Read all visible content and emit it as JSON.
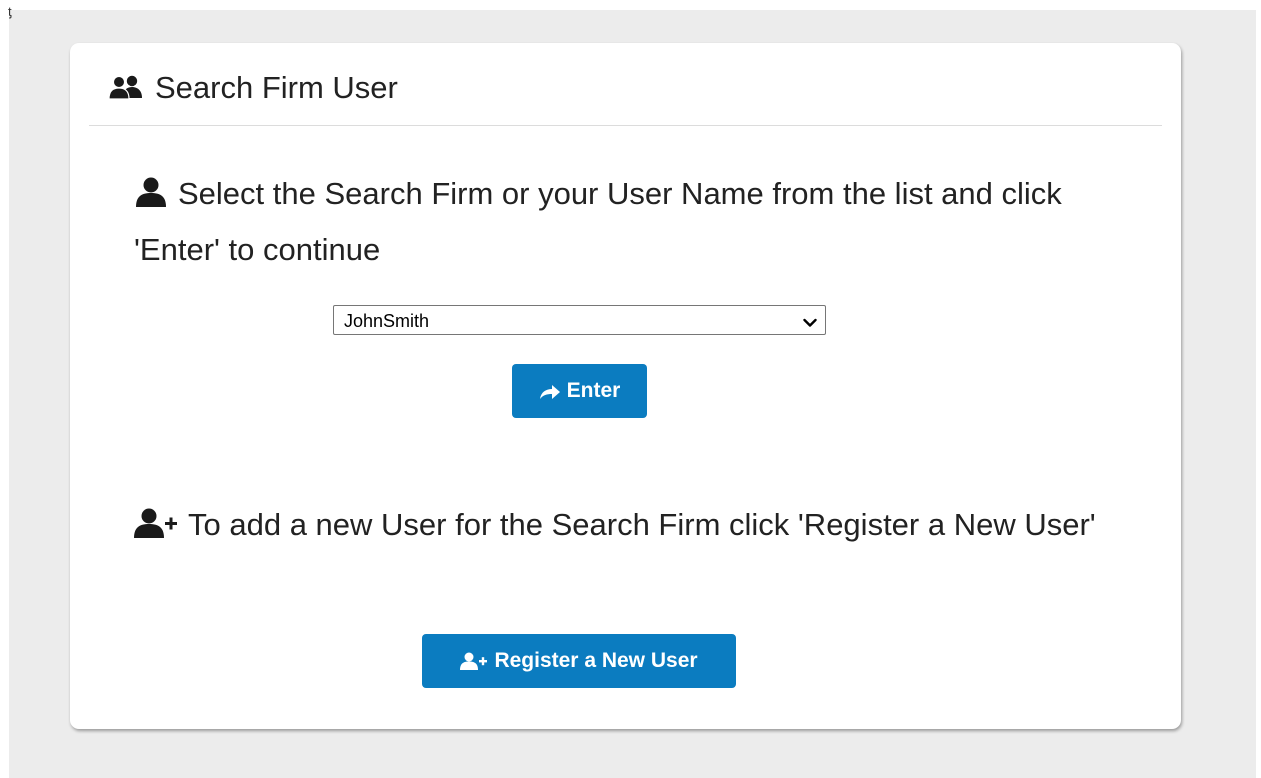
{
  "page": {
    "corner_glyph": "ƫ"
  },
  "card": {
    "title": "Search Firm User",
    "title_icon": "users-icon",
    "instruction_select": "Select the Search Firm or your User Name from the list and click 'Enter' to continue",
    "instruction_select_icon": "user-icon",
    "firm_select": {
      "selected": "JohnSmith"
    },
    "enter_button": {
      "label": "Enter",
      "icon": "share-arrow-icon"
    },
    "instruction_register": "To add a new User for the Search Firm click 'Register a New User'",
    "instruction_register_icon": "user-plus-icon",
    "register_button": {
      "label": "Register a New User",
      "icon": "user-plus-icon"
    }
  },
  "colors": {
    "button_bg": "#0b7cc0",
    "page_bg": "#ececec",
    "card_bg": "#ffffff"
  }
}
